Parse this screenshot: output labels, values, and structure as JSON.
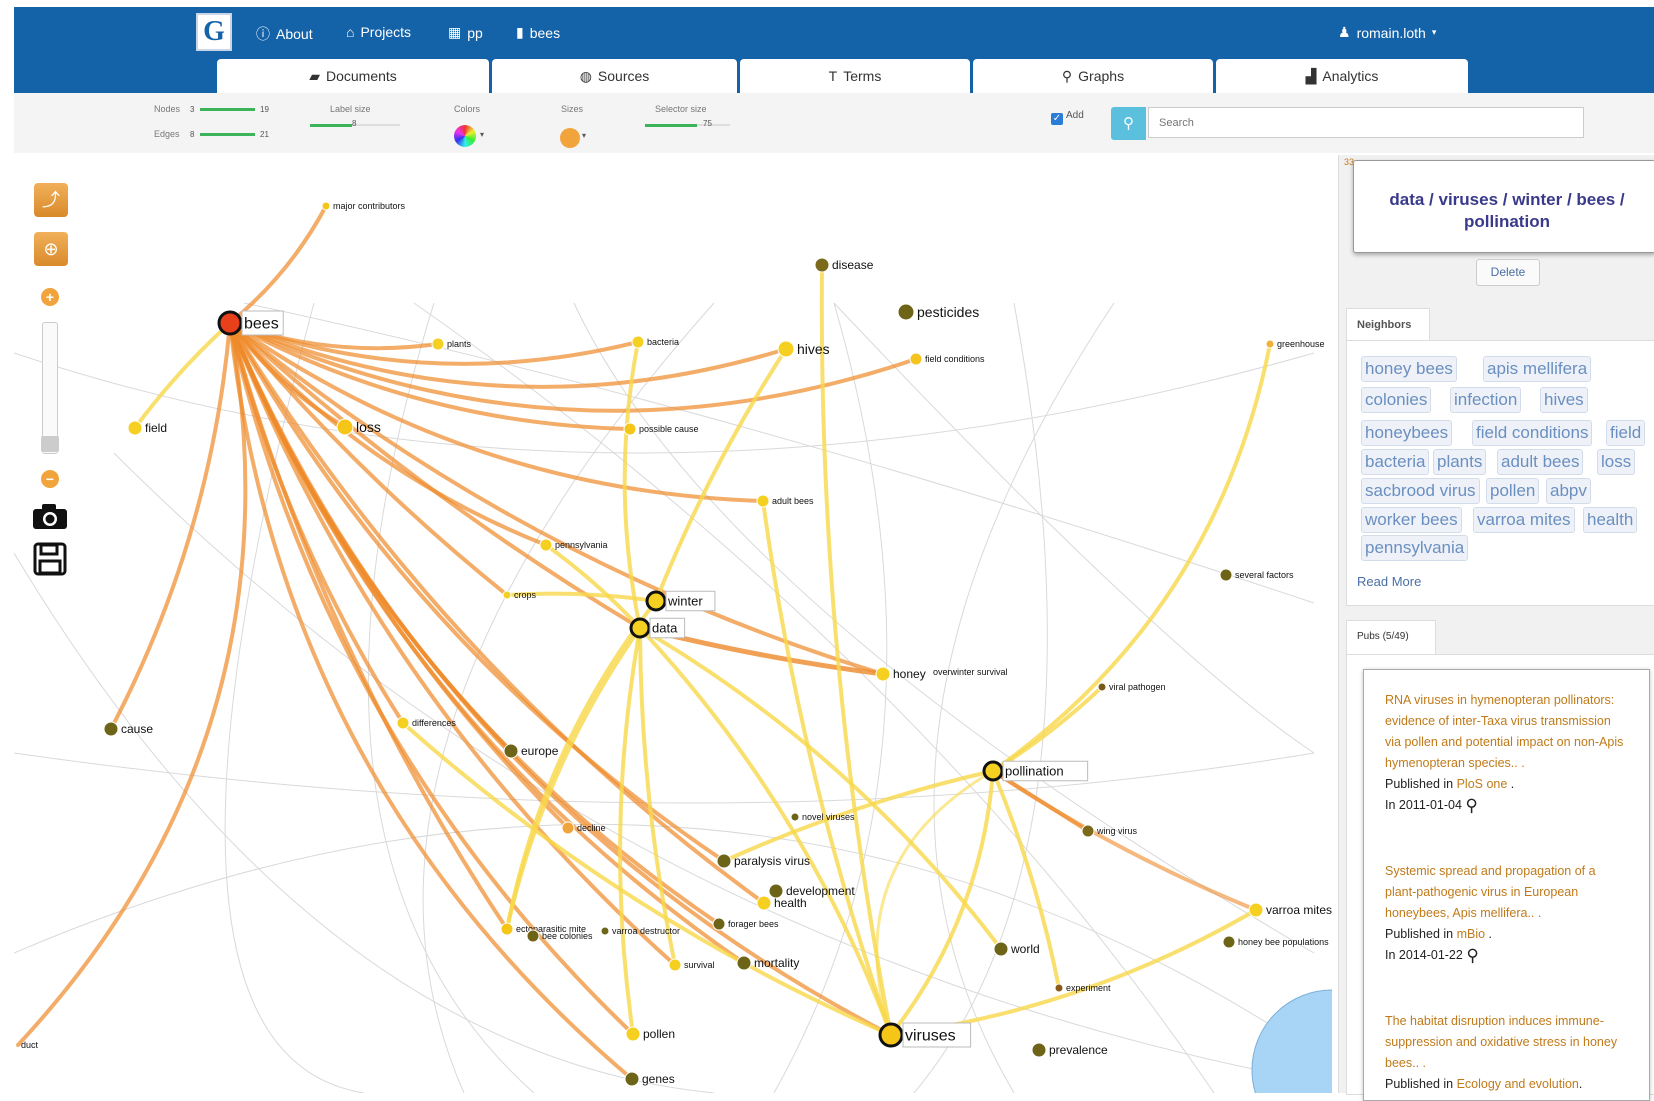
{
  "header": {
    "logo_letter": "G",
    "nav": [
      {
        "icon": "info-icon",
        "glyph": "ⓘ",
        "label": "About"
      },
      {
        "icon": "home-icon",
        "glyph": "⌂",
        "label": "Projects"
      },
      {
        "icon": "corpus-icon",
        "glyph": "▦",
        "label": "pp"
      },
      {
        "icon": "document-icon",
        "glyph": "▮",
        "label": "bees"
      }
    ],
    "user": "romain.loth"
  },
  "tabs": [
    {
      "icon": "folder-icon",
      "glyph": "▰",
      "label": "Documents"
    },
    {
      "icon": "globe-icon",
      "glyph": "◍",
      "label": "Sources"
    },
    {
      "icon": "text-icon",
      "glyph": "T",
      "label": "Terms"
    },
    {
      "icon": "map-marker-icon",
      "glyph": "⚲",
      "label": "Graphs"
    },
    {
      "icon": "bar-chart-icon",
      "glyph": "▟",
      "label": "Analytics"
    }
  ],
  "toolbar": {
    "nodes_label": "Nodes",
    "nodes_min": "3",
    "nodes_max": "19",
    "edges_label": "Edges",
    "edges_min": "8",
    "edges_max": "21",
    "label_size_label": "Label size",
    "label_size_value": "8",
    "colors_label": "Colors",
    "sizes_label": "Sizes",
    "selector_size_label": "Selector size",
    "selector_size_value": "75",
    "add_label": "Add",
    "search_placeholder": "Search"
  },
  "graph": {
    "nodes": [
      {
        "label": "bees",
        "color": "#e8401a",
        "kind": "big-selected"
      },
      {
        "label": "major contributors",
        "color": "#f5c518",
        "kind": "tiny"
      },
      {
        "label": "disease",
        "color": "#7a6a1a",
        "kind": "med"
      },
      {
        "label": "pesticides",
        "color": "#6e6418",
        "kind": "med-large"
      },
      {
        "label": "plants",
        "color": "#f5d020",
        "kind": "small"
      },
      {
        "label": "bacteria",
        "color": "#f5d020",
        "kind": "small"
      },
      {
        "label": "hives",
        "color": "#f5d020",
        "kind": "med-large"
      },
      {
        "label": "field conditions",
        "color": "#f5c21e",
        "kind": "small"
      },
      {
        "label": "greenhouse",
        "color": "#f0b03a",
        "kind": "tiny"
      },
      {
        "label": "field",
        "color": "#f5d020",
        "kind": "med"
      },
      {
        "label": "loss",
        "color": "#f5c518",
        "kind": "med-large"
      },
      {
        "label": "possible cause",
        "color": "#f5c518",
        "kind": "small"
      },
      {
        "label": "adult bees",
        "color": "#f5d020",
        "kind": "small"
      },
      {
        "label": "pennsylvania",
        "color": "#f5d020",
        "kind": "small"
      },
      {
        "label": "several factors",
        "color": "#6e6418",
        "kind": "small"
      },
      {
        "label": "crops",
        "color": "#f5d020",
        "kind": "tiny"
      },
      {
        "label": "winter",
        "color": "#f5d020",
        "kind": "selected"
      },
      {
        "label": "data",
        "color": "#f5d020",
        "kind": "selected"
      },
      {
        "label": "honey",
        "color": "#f5d020",
        "kind": "med"
      },
      {
        "label": "overwinter survival",
        "color": "#6e6418",
        "kind": "none"
      },
      {
        "label": "viral pathogen",
        "color": "#7a5a1a",
        "kind": "tiny"
      },
      {
        "label": "cause",
        "color": "#6e6418",
        "kind": "med"
      },
      {
        "label": "differences",
        "color": "#f5d020",
        "kind": "small"
      },
      {
        "label": "europe",
        "color": "#6e6418",
        "kind": "med"
      },
      {
        "label": "pollination",
        "color": "#f5d020",
        "kind": "selected"
      },
      {
        "label": "novel viruses",
        "color": "#6e6418",
        "kind": "tiny"
      },
      {
        "label": "decline",
        "color": "#f0a43a",
        "kind": "small"
      },
      {
        "label": "wing virus",
        "color": "#7a6a1a",
        "kind": "small"
      },
      {
        "label": "paralysis virus",
        "color": "#6e6418",
        "kind": "med"
      },
      {
        "label": "development",
        "color": "#6e6418",
        "kind": "med"
      },
      {
        "label": "health",
        "color": "#f5d020",
        "kind": "med"
      },
      {
        "label": "varroa mites",
        "color": "#f5d020",
        "kind": "med"
      },
      {
        "label": "ectoparasitic mite",
        "color": "#f5c518",
        "kind": "small"
      },
      {
        "label": "varroa destructor",
        "color": "#6e6418",
        "kind": "tiny"
      },
      {
        "label": "bee colonies",
        "color": "#6e6418",
        "kind": "small"
      },
      {
        "label": "forager bees",
        "color": "#6e6418",
        "kind": "small"
      },
      {
        "label": "honey bee populations",
        "color": "#6e6418",
        "kind": "small"
      },
      {
        "label": "world",
        "color": "#6e6418",
        "kind": "med"
      },
      {
        "label": "survival",
        "color": "#f5d020",
        "kind": "small"
      },
      {
        "label": "mortality",
        "color": "#6e6418",
        "kind": "med"
      },
      {
        "label": "experiment",
        "color": "#8a5a1a",
        "kind": "tiny"
      },
      {
        "label": "viruses",
        "color": "#f5c518",
        "kind": "big-selected"
      },
      {
        "label": "pollen",
        "color": "#f5d020",
        "kind": "med"
      },
      {
        "label": "prevalence",
        "color": "#6e6418",
        "kind": "med"
      },
      {
        "label": "genes",
        "color": "#6e6418",
        "kind": "med"
      },
      {
        "label": "duct",
        "color": "#6e6418",
        "kind": "none"
      }
    ]
  },
  "panel": {
    "top_marker": "33",
    "selection_title": "data / viruses / winter / bees / pollination",
    "delete_label": "Delete",
    "neighbors_tab": "Neighbors",
    "neighbors": [
      "honey bees",
      "apis mellifera",
      "colonies",
      "infection",
      "hives",
      "honeybees",
      "field conditions",
      "field",
      "bacteria",
      "plants",
      "adult bees",
      "loss",
      "sacbrood virus",
      "pollen",
      "abpv",
      "worker bees",
      "varroa mites",
      "health",
      "pennsylvania"
    ],
    "read_more": "Read More",
    "pubs_tab": "Pubs (5/49)",
    "pubs": [
      {
        "title": "RNA viruses in hymenopteran pollinators: evidence of inter-Taxa virus transmission via pollen and potential impact on non-Apis hymenopteran species.. .",
        "published_prefix": "Published in ",
        "source": "PloS one",
        "date_line": "In 2011-01-04"
      },
      {
        "title": "Systemic spread and propagation of a plant-pathogenic virus in European honeybees, Apis mellifera.. .",
        "published_prefix": "Published in ",
        "source": "mBio",
        "date_line": "In 2014-01-22"
      },
      {
        "title": "The habitat disruption induces immune-suppression and oxidative stress in honey bees.. .",
        "published_prefix": "Published in ",
        "source": "Ecology and evolution",
        "date_line": ""
      }
    ]
  },
  "colors": {
    "header_bg": "#1462a8",
    "edge_orange": "#ee8a2a",
    "edge_yellow": "#f7d84a",
    "search_btn": "#5bc0de"
  }
}
